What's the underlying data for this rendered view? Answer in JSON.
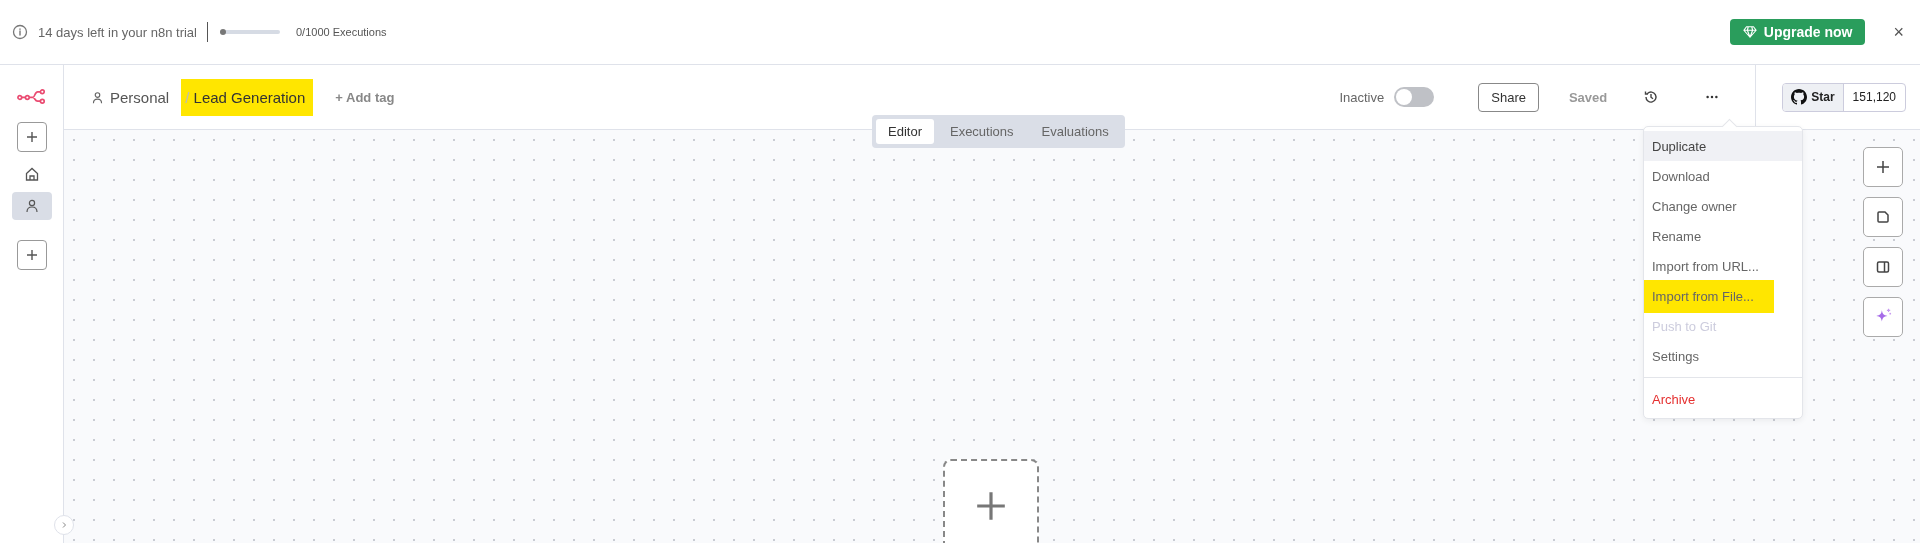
{
  "trial_banner": {
    "message": "14 days left in your n8n trial",
    "executions": {
      "level": 0,
      "label": "0/1000 Executions"
    },
    "upgrade_button": "Upgrade now",
    "close": "×"
  },
  "breadcrumb": {
    "project": "Personal",
    "separator": "/",
    "workflow": {
      "name": "Lead Generation",
      "highlighted": true
    },
    "add_tag": "+ Add tag"
  },
  "view_tabs": [
    {
      "label": "Editor",
      "selected": true
    },
    {
      "label": "Executions",
      "selected": false
    },
    {
      "label": "Evaluations",
      "selected": false
    }
  ],
  "status": {
    "label": "Inactive",
    "on": false
  },
  "share_button": "Share",
  "save_state": "Saved",
  "github": {
    "star": "Star",
    "count": "151,120"
  },
  "sidebar": [
    {
      "kind": "add"
    },
    {
      "kind": "home",
      "selected": false
    },
    {
      "kind": "person",
      "selected": true
    },
    {
      "kind": "add"
    }
  ],
  "menu": [
    {
      "label": "Duplicate",
      "selected": true,
      "disabled": false,
      "highlighted": false,
      "kind": "item"
    },
    {
      "label": "Download",
      "selected": false,
      "disabled": false,
      "highlighted": false,
      "kind": "item"
    },
    {
      "label": "Change owner",
      "selected": false,
      "disabled": false,
      "highlighted": false,
      "kind": "item"
    },
    {
      "label": "Rename",
      "selected": false,
      "disabled": false,
      "highlighted": false,
      "kind": "item"
    },
    {
      "label": "Import from URL...",
      "selected": false,
      "disabled": false,
      "highlighted": false,
      "kind": "item"
    },
    {
      "label": "Import from File...",
      "selected": false,
      "disabled": false,
      "highlighted": true,
      "kind": "item"
    },
    {
      "label": "Push to Git",
      "selected": false,
      "disabled": true,
      "highlighted": false,
      "kind": "item"
    },
    {
      "label": "Settings",
      "selected": false,
      "disabled": false,
      "highlighted": false,
      "kind": "item"
    },
    {
      "label": "Archive",
      "selected": false,
      "disabled": false,
      "highlighted": false,
      "kind": "danger"
    }
  ],
  "canvas_tools": [
    {
      "kind": "add"
    },
    {
      "kind": "note"
    },
    {
      "kind": "panel"
    },
    {
      "kind": "ai"
    }
  ]
}
